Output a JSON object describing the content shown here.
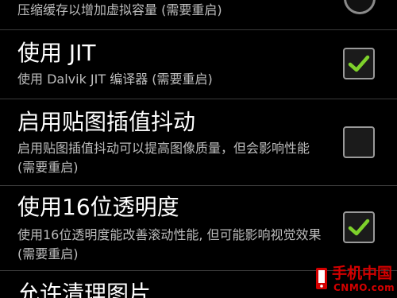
{
  "settings": [
    {
      "title": "",
      "summary": "压缩缓存以增加虚拟容量 (需要重启)",
      "control": "partial-round-switch"
    },
    {
      "title": "使用 JIT",
      "summary": "使用 Dalvik JIT 编译器 (需要重启)",
      "checked": true
    },
    {
      "title": "启用贴图插值抖动",
      "summary": "启用贴图插值抖动可以提高图像质量，但会影响性能 (需要重启)",
      "checked": false
    },
    {
      "title": "使用16位透明度",
      "summary": "使用16位透明度能改善滚动性能, 但可能影响视觉效果 (需要重启)",
      "checked": true
    },
    {
      "title": "允许清理图片",
      "summary": ""
    }
  ],
  "watermark": {
    "text_cn": "手机中国",
    "text_en": "CNMO.com"
  },
  "colors": {
    "background": "#000000",
    "divider": "#3a3a3a",
    "summary_text": "#bdbdbd",
    "check_green": "#7ed12b",
    "watermark_red": "#d40000"
  }
}
